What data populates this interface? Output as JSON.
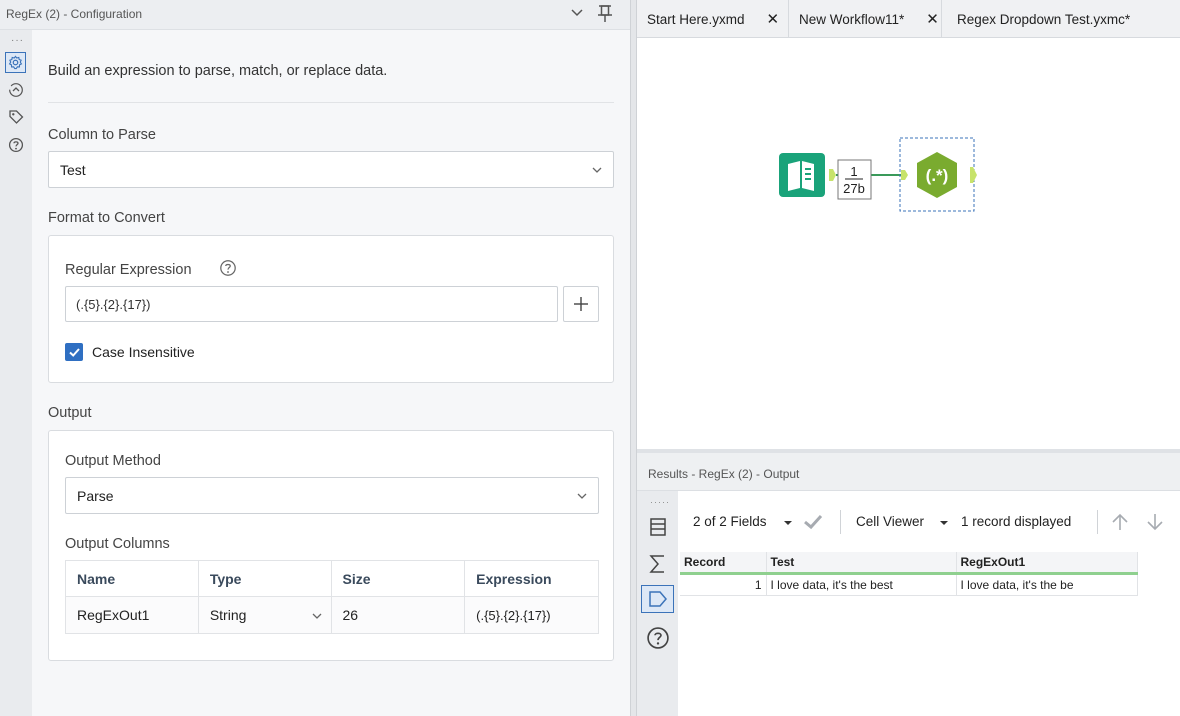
{
  "config": {
    "title": "RegEx (2) - Configuration",
    "description": "Build an expression to parse, match, or replace data.",
    "column_to_parse": {
      "label": "Column to Parse",
      "value": "Test"
    },
    "format_to_convert": {
      "label": "Format to Convert",
      "regex_label": "Regular Expression",
      "regex_value": "(.{5}.{2}.{17})",
      "case_insensitive_label": "Case Insensitive",
      "case_insensitive_checked": true
    },
    "output": {
      "label": "Output",
      "method_label": "Output Method",
      "method_value": "Parse",
      "columns_label": "Output Columns",
      "columns_headers": [
        "Name",
        "Type",
        "Size",
        "Expression"
      ],
      "rows": [
        {
          "name": "RegExOut1",
          "type": "String",
          "size": "26",
          "expression": "(.{5}.{2}.{17})"
        }
      ]
    }
  },
  "tabs": [
    {
      "label": "Start Here.yxmd"
    },
    {
      "label": "New Workflow11*"
    },
    {
      "label": "Regex Dropdown Test.yxmc*"
    }
  ],
  "canvas": {
    "connection_count": "1",
    "connection_size": "27b"
  },
  "results": {
    "title": "Results - RegEx (2) - Output",
    "fields_label": "2 of 2 Fields",
    "cell_viewer_label": "Cell Viewer",
    "record_count_label": "1 record displayed",
    "headers": [
      "Record",
      "Test",
      "RegExOut1"
    ],
    "rows": [
      {
        "record": "1",
        "test": "I love data, it's the best",
        "regexout1": "I love data, it's the be"
      }
    ]
  },
  "colors": {
    "accent_blue": "#2f6fc2",
    "tool_green": "#1aa37a",
    "regex_tool_green": "#7aab2f"
  }
}
